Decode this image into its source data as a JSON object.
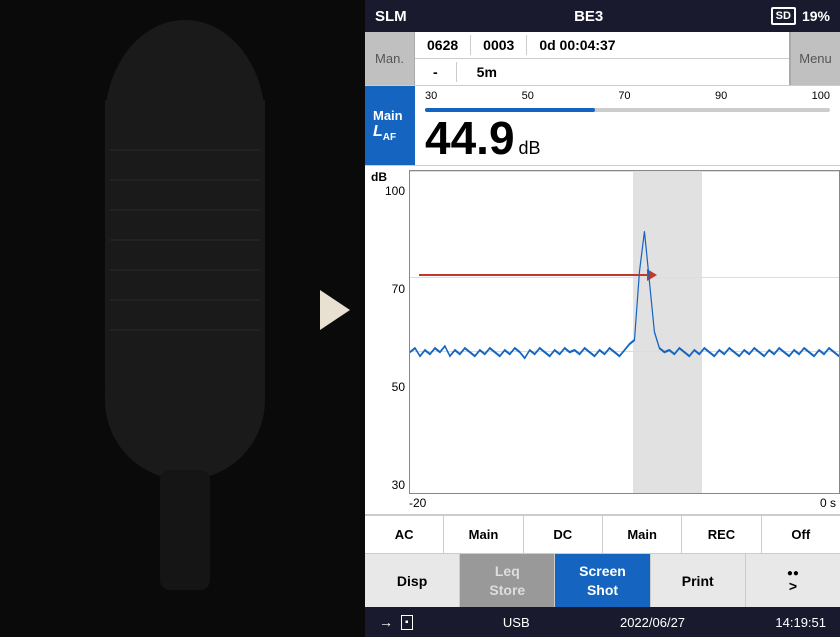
{
  "left_panel": {
    "label": "microphone-silhouette"
  },
  "top_bar": {
    "left_label": "SLM",
    "center_label": "BE3",
    "sd_icon": "SD",
    "battery_percent": "19%"
  },
  "header": {
    "man_label": "Man.",
    "num1": "0628",
    "num2": "0003",
    "time": "0d 00:04:37",
    "dash": "-",
    "interval": "5m",
    "menu_label": "Menu"
  },
  "measurement": {
    "main_label": "Main",
    "laf_label": "LAF",
    "scale_min": "30",
    "scale_mid1": "50",
    "scale_mid2": "70",
    "scale_mid3": "90",
    "scale_max": "100",
    "bar_fill_percent": 42,
    "value": "44.9",
    "unit": "dB"
  },
  "chart": {
    "y_title": "dB",
    "y_labels": [
      "100",
      "70",
      "50",
      "30"
    ],
    "x_labels": [
      "-20",
      "0 s"
    ],
    "highlight_left_pct": 52,
    "highlight_width_pct": 16
  },
  "btn_row1": {
    "cells": [
      "AC",
      "Main",
      "DC",
      "Main",
      "REC",
      "Off"
    ]
  },
  "btn_row2": {
    "cells": [
      {
        "label": "Disp",
        "state": "normal"
      },
      {
        "label": "Leq\nStore",
        "state": "grayed"
      },
      {
        "label": "Screen\nShot",
        "state": "active"
      },
      {
        "label": "Print",
        "state": "normal"
      },
      {
        "label": "•\n>",
        "state": "normal"
      }
    ]
  },
  "status_bar": {
    "arrow_label": "→",
    "usb_label": "USB",
    "date_label": "2022/06/27",
    "time_label": "14:19:51"
  }
}
